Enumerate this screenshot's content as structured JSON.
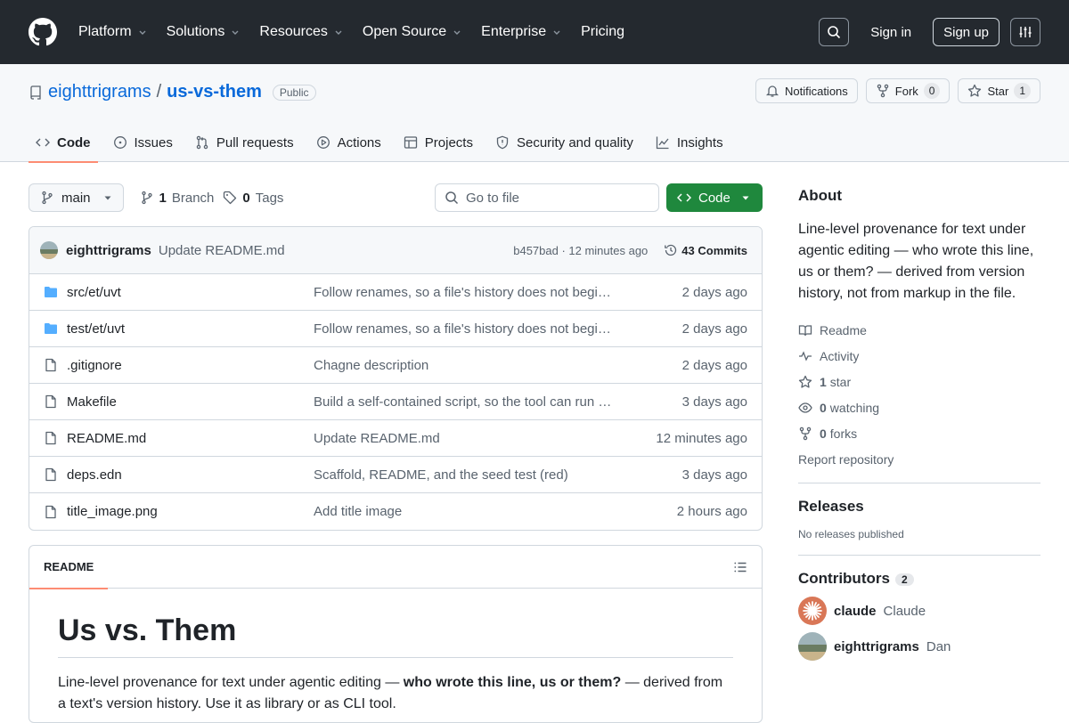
{
  "topnav": {
    "items": [
      {
        "label": "Platform",
        "dropdown": true
      },
      {
        "label": "Solutions",
        "dropdown": true
      },
      {
        "label": "Resources",
        "dropdown": true
      },
      {
        "label": "Open Source",
        "dropdown": true
      },
      {
        "label": "Enterprise",
        "dropdown": true
      },
      {
        "label": "Pricing",
        "dropdown": false
      }
    ],
    "sign_in": "Sign in",
    "sign_up": "Sign up"
  },
  "repo": {
    "owner": "eighttrigrams",
    "name": "us-vs-them",
    "visibility": "Public",
    "notifications_label": "Notifications",
    "fork_label": "Fork",
    "fork_count": "0",
    "star_label": "Star",
    "star_count": "1"
  },
  "tabs": [
    {
      "label": "Code",
      "icon": "code-icon",
      "active": true
    },
    {
      "label": "Issues",
      "icon": "issue-icon"
    },
    {
      "label": "Pull requests",
      "icon": "pull-request-icon"
    },
    {
      "label": "Actions",
      "icon": "play-icon"
    },
    {
      "label": "Projects",
      "icon": "table-icon"
    },
    {
      "label": "Security and quality",
      "icon": "shield-icon"
    },
    {
      "label": "Insights",
      "icon": "graph-icon"
    }
  ],
  "toolbar": {
    "branch": "main",
    "branch_count": "1",
    "branch_label": "Branch",
    "tag_count": "0",
    "tag_label": "Tags",
    "goto_placeholder": "Go to file",
    "code_label": "Code"
  },
  "commit": {
    "author": "eighttrigrams",
    "message": "Update README.md",
    "meta": "b457bad · 12 minutes ago",
    "commits_label": "43 Commits"
  },
  "files": [
    {
      "type": "folder",
      "name": "src/et/uvt",
      "message": "Follow renames, so a file's history does not begin at its last rename",
      "date": "2 days ago"
    },
    {
      "type": "folder",
      "name": "test/et/uvt",
      "message": "Follow renames, so a file's history does not begin at its last rename",
      "date": "2 days ago"
    },
    {
      "type": "file",
      "name": ".gitignore",
      "message": "Chagne description",
      "date": "2 days ago"
    },
    {
      "type": "file",
      "name": "Makefile",
      "message": "Build a self-contained script, so the tool can run without a clone",
      "date": "3 days ago"
    },
    {
      "type": "file",
      "name": "README.md",
      "message": "Update README.md",
      "date": "12 minutes ago"
    },
    {
      "type": "file",
      "name": "deps.edn",
      "message": "Scaffold, README, and the seed test (red)",
      "date": "3 days ago"
    },
    {
      "type": "file",
      "name": "title_image.png",
      "message": "Add title image",
      "date": "2 hours ago"
    }
  ],
  "readme": {
    "tab": "README",
    "heading": "Us vs. Them",
    "intro_pre": "Line-level provenance for text under agentic editing — ",
    "intro_bold": "who wrote this line, us or them?",
    "intro_post": " — derived from a text's version history. Use it as library or as CLI tool."
  },
  "about": {
    "title": "About",
    "description": "Line-level provenance for text under agentic editing — who wrote this line, us or them? — derived from version history, not from markup in the file.",
    "readme": "Readme",
    "activity": "Activity",
    "stars_count": "1",
    "stars_label": "star",
    "watching_count": "0",
    "watching_label": "watching",
    "forks_count": "0",
    "forks_label": "forks",
    "report": "Report repository"
  },
  "releases": {
    "title": "Releases",
    "empty": "No releases published"
  },
  "contributors": {
    "title": "Contributors",
    "count": "2",
    "list": [
      {
        "login": "claude",
        "name": "Claude"
      },
      {
        "login": "eighttrigrams",
        "name": "Dan"
      }
    ]
  },
  "colors": {
    "header_bg": "#24292f",
    "link": "#0969da",
    "primary_button": "#1f883d",
    "tab_underline": "#fd8c73",
    "folder": "#54aeff"
  }
}
